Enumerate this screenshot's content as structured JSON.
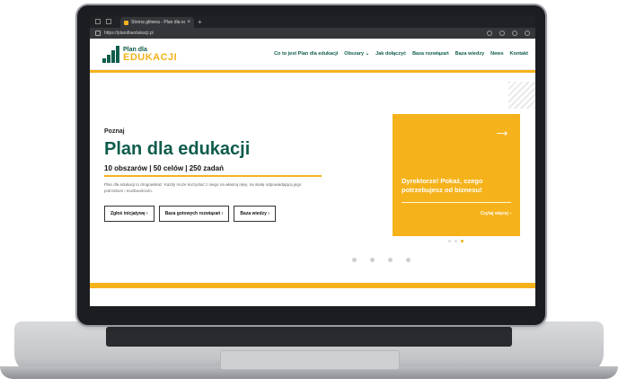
{
  "browser": {
    "tab_title": "Strona główna - Plan dla eduk...",
    "tab_close": "×",
    "new_tab": "+",
    "url": "https://plandlaedukacji.pl"
  },
  "logo": {
    "line1": "Plan dla",
    "line2": "EDUKACJI"
  },
  "nav": [
    "Co to jest Plan dla edukacji",
    "Obszary ⌄",
    "Jak dołączyć",
    "Baza rozwiązań",
    "Baza wiedzy",
    "News",
    "Kontakt"
  ],
  "hero": {
    "eyebrow": "Poznaj",
    "title": "Plan dla edukacji",
    "subtitle": "10 obszarów | 50 celów | 250 zadań",
    "description": "Plan dla edukacji to drogowskaz. Każdy może korzystać z niego na własną rękę, na skalę odpowiadającą jego potrzebom i możliwościom.",
    "buttons": [
      "Zgłoś inicjatywę ›",
      "Baza gotowych rozwiązań ›",
      "Baza wiedzy ›"
    ]
  },
  "card": {
    "arrow": "→",
    "text": "Dyrektorze! Pokaż, czego potrzebujesz od biznesu!",
    "link": "Czytaj więcej ›"
  },
  "colors": {
    "brand_green": "#0e5c4c",
    "brand_yellow": "#f5b21b"
  }
}
